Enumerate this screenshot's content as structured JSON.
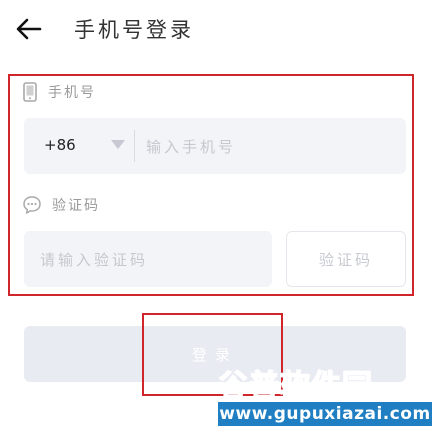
{
  "header": {
    "title": "手机号登录"
  },
  "form": {
    "phone_label": "手机号",
    "country_code": "+86",
    "phone_placeholder": "输入手机号",
    "code_label": "验证码",
    "code_placeholder": "请输入验证码",
    "get_code_button": "验证码"
  },
  "login": {
    "button_label": "登录"
  },
  "watermark": {
    "name_part1": "谷普",
    "name_part2": "软件园",
    "url": "www.gupuxiazai.com"
  },
  "icons": {
    "back": "arrow-left-icon",
    "phone": "phone-icon",
    "code": "chat-bubble-icon"
  },
  "colors": {
    "highlight": "#d0252b",
    "field_bg": "#f3f4f8",
    "login_bg": "#e9ebf2",
    "watermark_green": "#2aa64a",
    "watermark_blue": "#2c74c8"
  }
}
